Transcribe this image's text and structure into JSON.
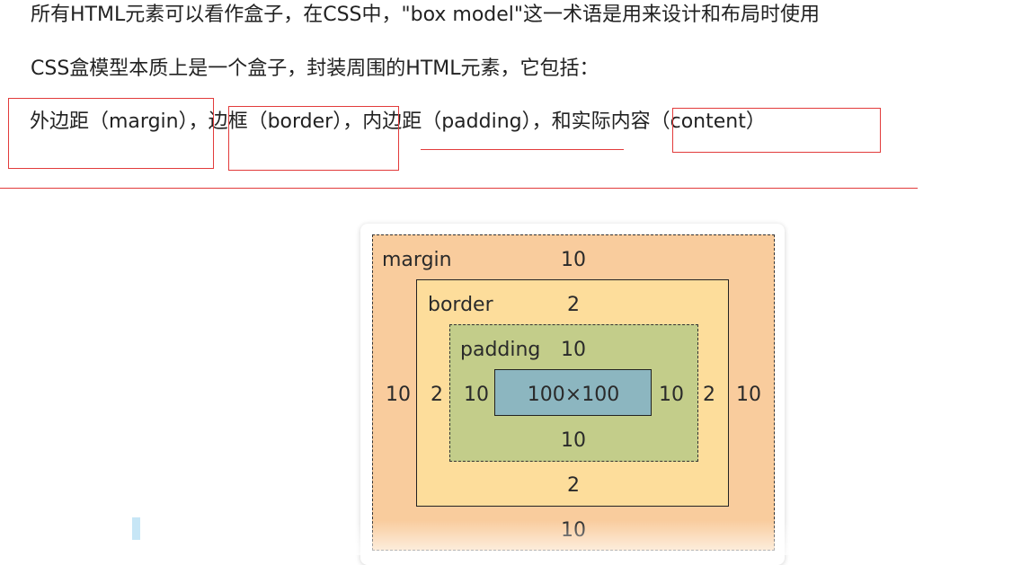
{
  "article": {
    "line1": "所有HTML元素可以看作盒子，在CSS中，\"box model\"这一术语是用来设计和布局时使用",
    "line2": "CSS盒模型本质上是一个盒子，封装周围的HTML元素，它包括：",
    "line3": "外边距（margin），边框（border），内边距（padding），和实际内容（content）"
  },
  "diagram": {
    "margin_label": "margin",
    "margin_top": "10",
    "margin_left": "10",
    "margin_right": "10",
    "margin_bottom": "10",
    "border_label": "border",
    "border_top": "2",
    "border_left": "2",
    "border_right": "2",
    "border_bottom": "2",
    "padding_label": "padding",
    "padding_top": "10",
    "padding_left": "10",
    "padding_right": "10",
    "padding_bottom": "10",
    "content_size": "100×100"
  },
  "colors": {
    "annotation": "#e23b3b",
    "margin_fill": "#f9cc9d",
    "border_fill": "#fddd9b",
    "padding_fill": "#c3cd8a",
    "content_fill": "#8cb6c0"
  }
}
